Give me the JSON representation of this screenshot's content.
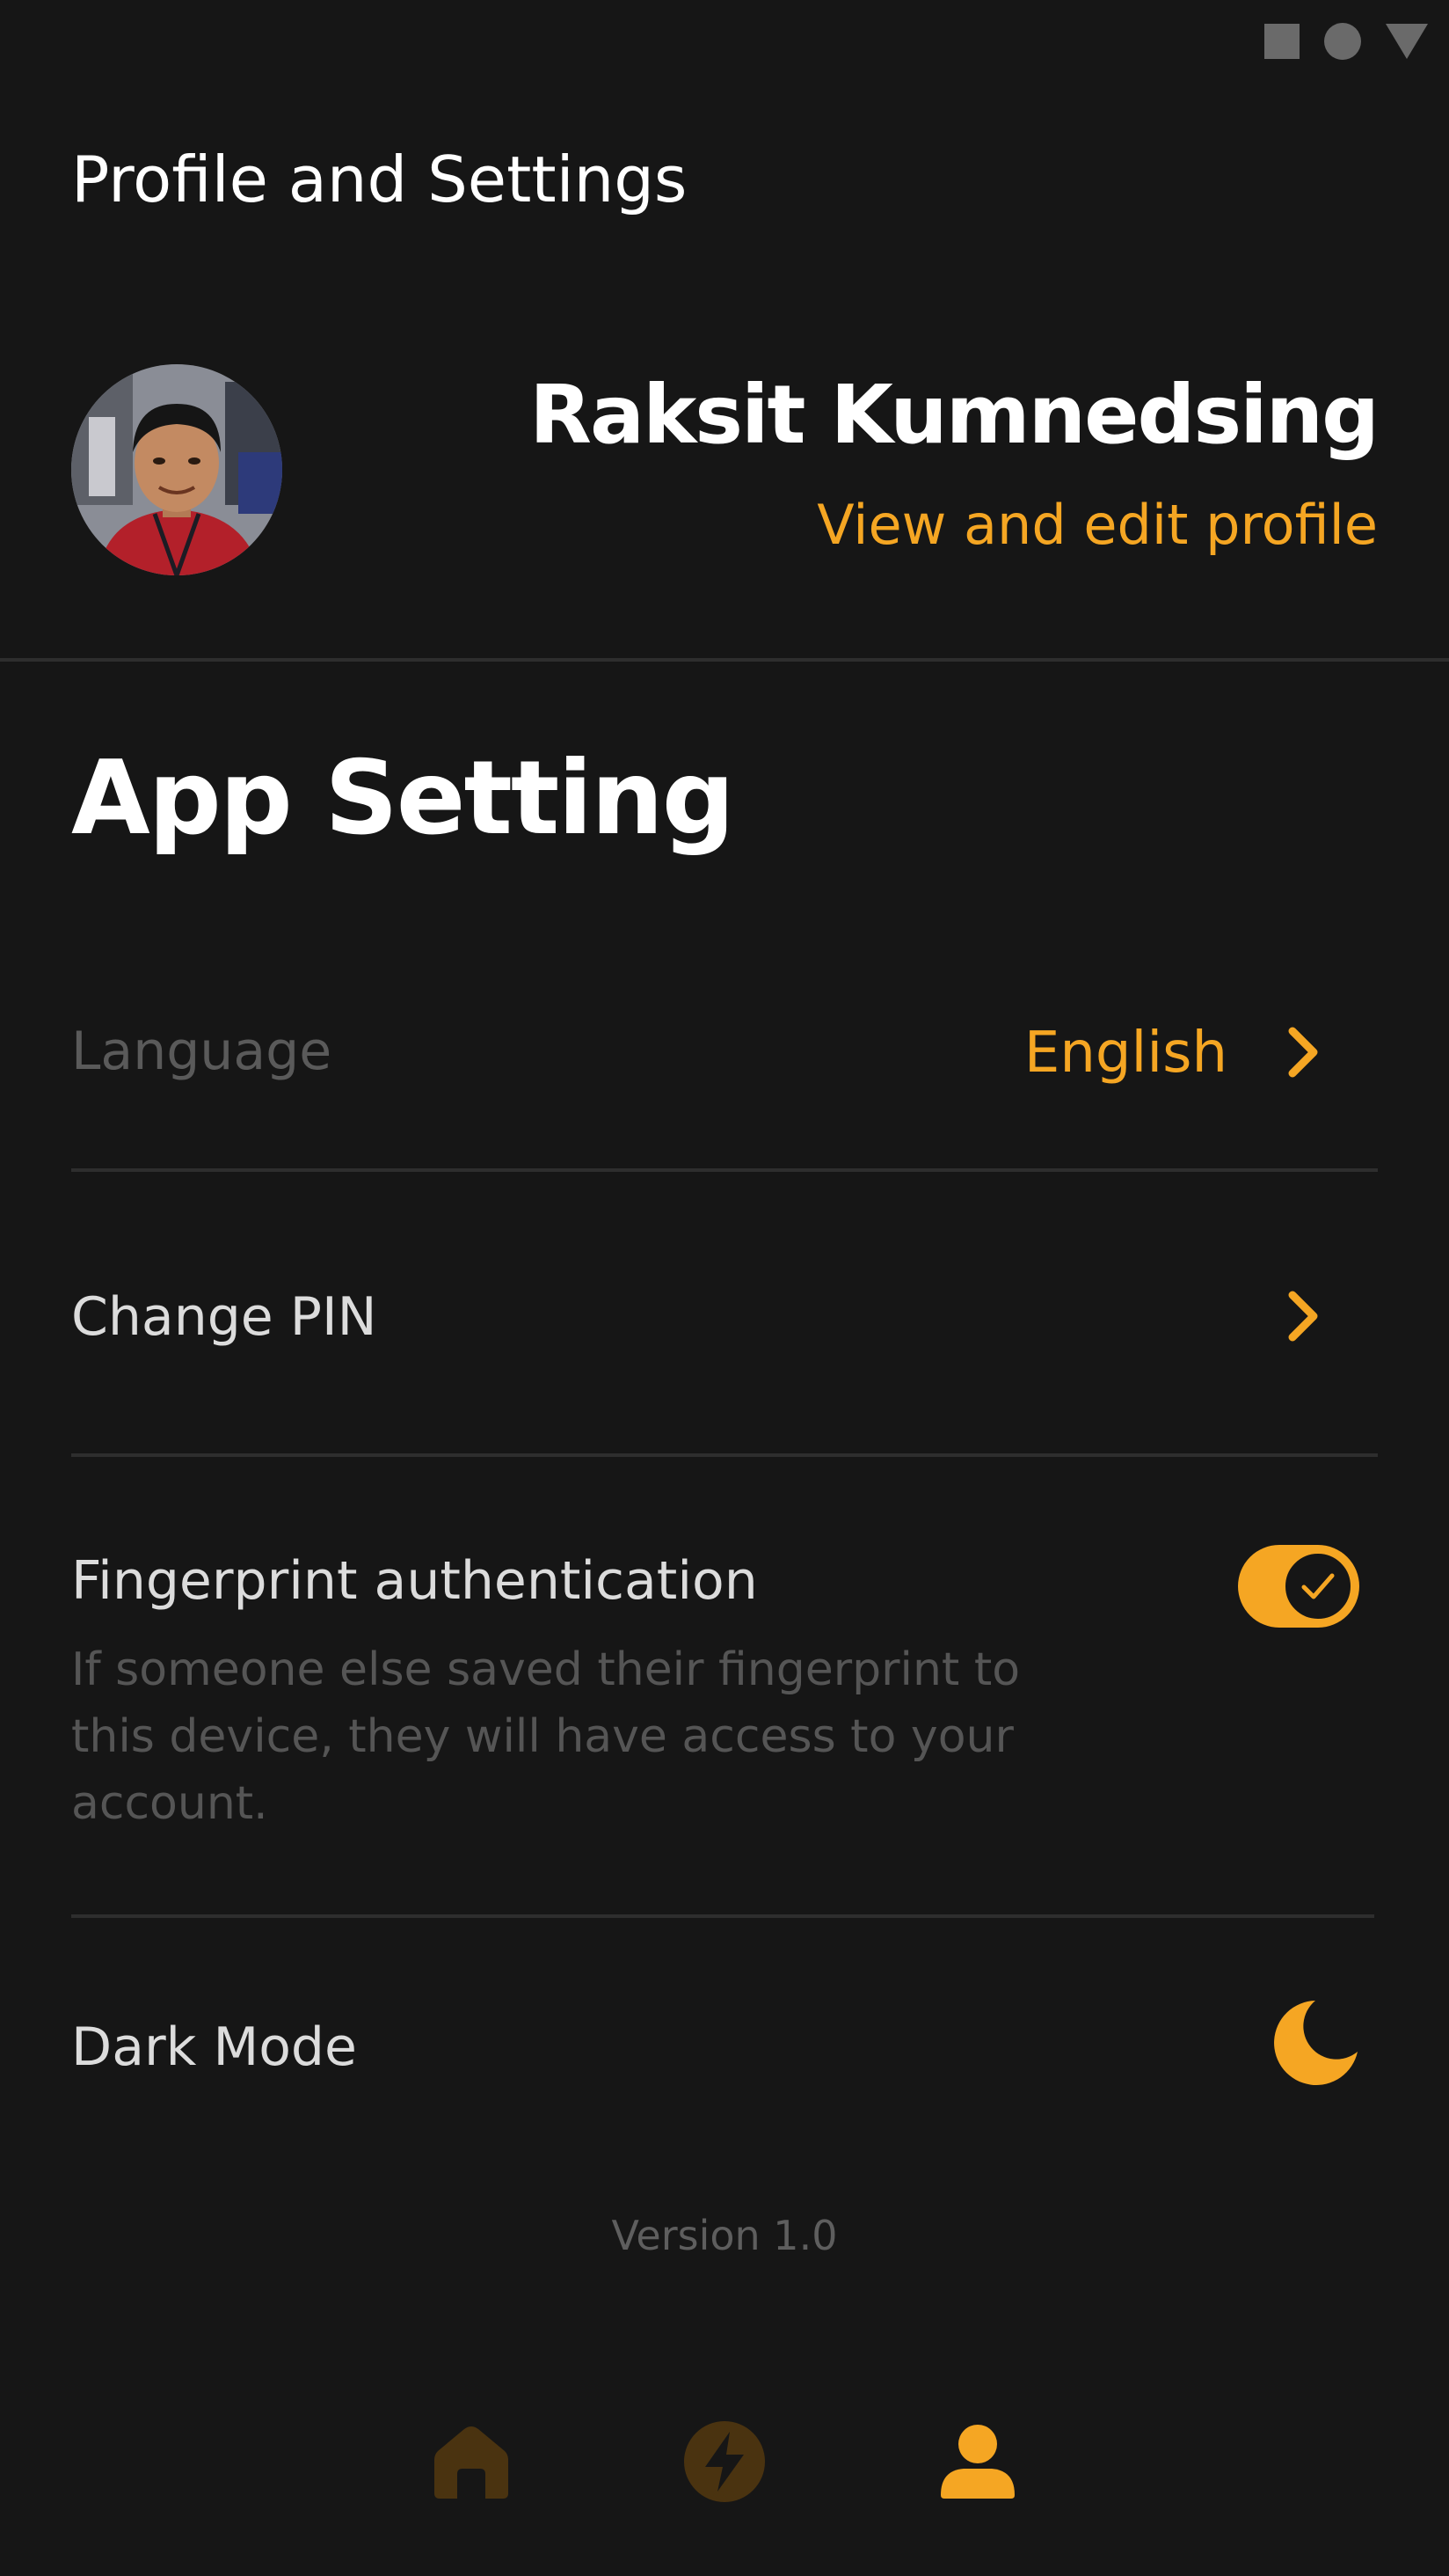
{
  "header": {
    "title": "Profile and Settings"
  },
  "profile": {
    "name": "Raksit Kumnedsing",
    "link_label": "View and edit profile"
  },
  "settings": {
    "section_title": "App Setting",
    "language": {
      "label": "Language",
      "value": "English"
    },
    "change_pin": {
      "label": "Change PIN"
    },
    "fingerprint": {
      "label": "Fingerprint authentication",
      "description": "If someone else saved their fingerprint to this device, they will have access to your account.",
      "enabled": true
    },
    "dark_mode": {
      "label": "Dark Mode",
      "icon": "moon-icon",
      "enabled": true
    }
  },
  "footer": {
    "version": "Version 1.0"
  },
  "bottom_nav": {
    "items": [
      {
        "icon": "home-icon",
        "active": false
      },
      {
        "icon": "lightning-icon",
        "active": false
      },
      {
        "icon": "profile-icon",
        "active": true
      }
    ]
  },
  "colors": {
    "background": "#161616",
    "accent": "#f5a623",
    "divider": "#2e2e2e",
    "inactive_nav": "#4a3310"
  }
}
